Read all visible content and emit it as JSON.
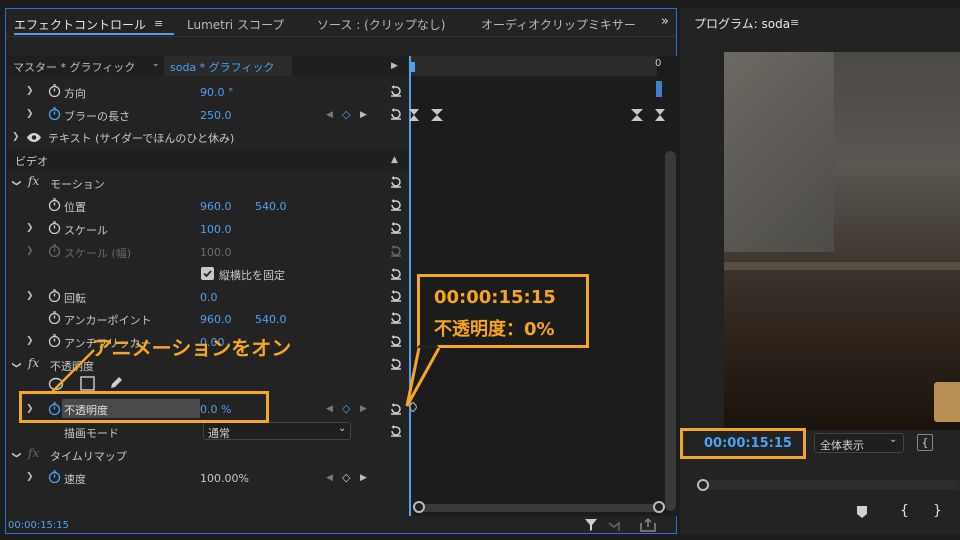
{
  "effect_controls": {
    "tabs": [
      {
        "label": "エフェクトコントロール"
      },
      {
        "label": "Lumetri スコープ"
      },
      {
        "label": "ソース : (クリップなし)"
      },
      {
        "label": "オーディオクリップミキサー"
      }
    ],
    "overflow": "»",
    "menu": "≡",
    "master_label": "マスター * グラフィック",
    "clip_label": "soda * グラフィック",
    "timeline_zero": "0",
    "rows": {
      "direction": {
        "label": "方向",
        "value": "90.0 °"
      },
      "blur_length": {
        "label": "ブラーの長さ",
        "value": "250.0"
      },
      "text_layer": {
        "label": "テキスト (サイダーでほんのひと休み)"
      },
      "video_header": {
        "label": "ビデオ"
      },
      "motion": {
        "label": "モーション"
      },
      "position": {
        "label": "位置",
        "value_x": "960.0",
        "value_y": "540.0"
      },
      "scale": {
        "label": "スケール",
        "value": "100.0"
      },
      "scale_width": {
        "label": "スケール (幅)",
        "value": "100.0"
      },
      "uniform_scale": {
        "label": "縦横比を固定",
        "checked": true
      },
      "rotation": {
        "label": "回転",
        "value": "0.0"
      },
      "anchor": {
        "label": "アンカーポイント",
        "value_x": "960.0",
        "value_y": "540.0"
      },
      "antiflicker": {
        "label": "アンチフリッカー",
        "value": "0.00"
      },
      "opacity_fx": {
        "label": "不透明度"
      },
      "opacity": {
        "label": "不透明度",
        "value": "0.0 %"
      },
      "blend_mode": {
        "label": "描画モード",
        "value": "通常"
      },
      "time_remap": {
        "label": "タイムリマップ"
      },
      "speed": {
        "label": "速度",
        "value": "100.00%"
      }
    },
    "footer_timecode": "00:00:15:15"
  },
  "callouts": {
    "timecode": "00:00:15:15",
    "opacity_readout": "不透明度：0%",
    "animation_on": "アニメーションをオン"
  },
  "program": {
    "title": "プログラム: soda",
    "menu": "≡",
    "timecode": "00:00:15:15",
    "zoom": "全体表示"
  },
  "colors": {
    "accent": "#4ea1f3",
    "callout": "#f5a623",
    "panel_border": "#2e6fd6"
  }
}
